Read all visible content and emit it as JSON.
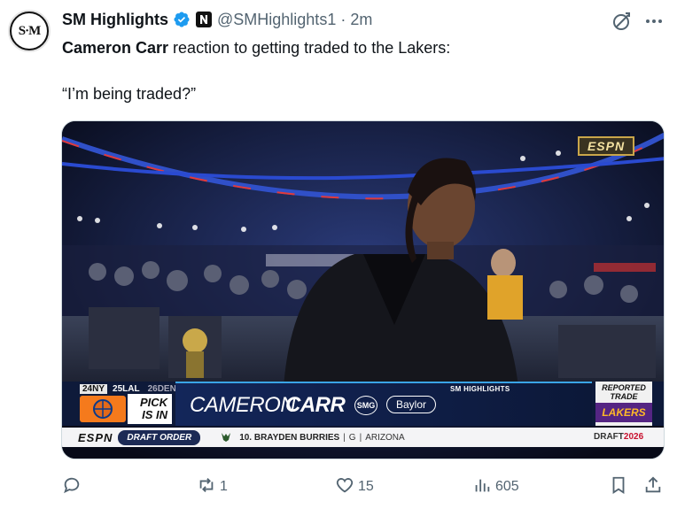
{
  "author": {
    "avatar_text": "S·M",
    "display_name": "SM Highlights",
    "handle": "@SMHighlights1",
    "separator": "·",
    "time": "2m"
  },
  "tweet": {
    "name": "Cameron Carr",
    "text_rest": " reaction to getting traded to the Lakers:",
    "quote": "“I’m being traded?”"
  },
  "media": {
    "broadcaster_bug": "ESPN",
    "pick_strip": {
      "p24": "24NY",
      "p25": "25LAL",
      "p26": "26DEN"
    },
    "pick_status": "PICK IS IN",
    "overlay_tag": "SM HIGHLIGHTS",
    "player_first": "CAMERON",
    "player_last": "CARR",
    "logo_text": "SMG",
    "school": "Baylor",
    "reported_trade": "REPORTED TRADE",
    "lakers": "LAKERS",
    "ticker": {
      "network": "ESPN",
      "label": "DRAFT ORDER",
      "pick": "10. BRAYDEN BURRIES",
      "sep1": "|",
      "position": "G",
      "sep2": "|",
      "school": "ARIZONA",
      "draft": "DRAFT",
      "year": "2026"
    }
  },
  "actions": {
    "replies": "",
    "reposts": "1",
    "likes": "15",
    "views": "605"
  },
  "colors": {
    "text": "#0f1419",
    "muted": "#536471",
    "verified": "#1d9bf0"
  }
}
